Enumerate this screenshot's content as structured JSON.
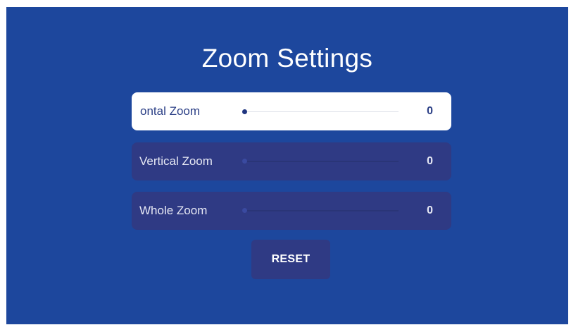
{
  "page": {
    "title": "Zoom Settings"
  },
  "settings": [
    {
      "label": "Horizontal Zoom",
      "visible_label": "ontal Zoom",
      "value": "0",
      "level": 0,
      "focused": true
    },
    {
      "label": "Vertical Zoom",
      "visible_label": "Vertical Zoom",
      "value": "0",
      "level": 0,
      "focused": false
    },
    {
      "label": "Whole Zoom",
      "visible_label": "Whole Zoom",
      "value": "0",
      "level": 0,
      "focused": false
    }
  ],
  "reset_button": {
    "label": "RESET"
  },
  "colors": {
    "background": "#1d479d",
    "row": "#2f3a84",
    "row_focused": "#ffffff",
    "text_focused": "#2b3f86"
  }
}
